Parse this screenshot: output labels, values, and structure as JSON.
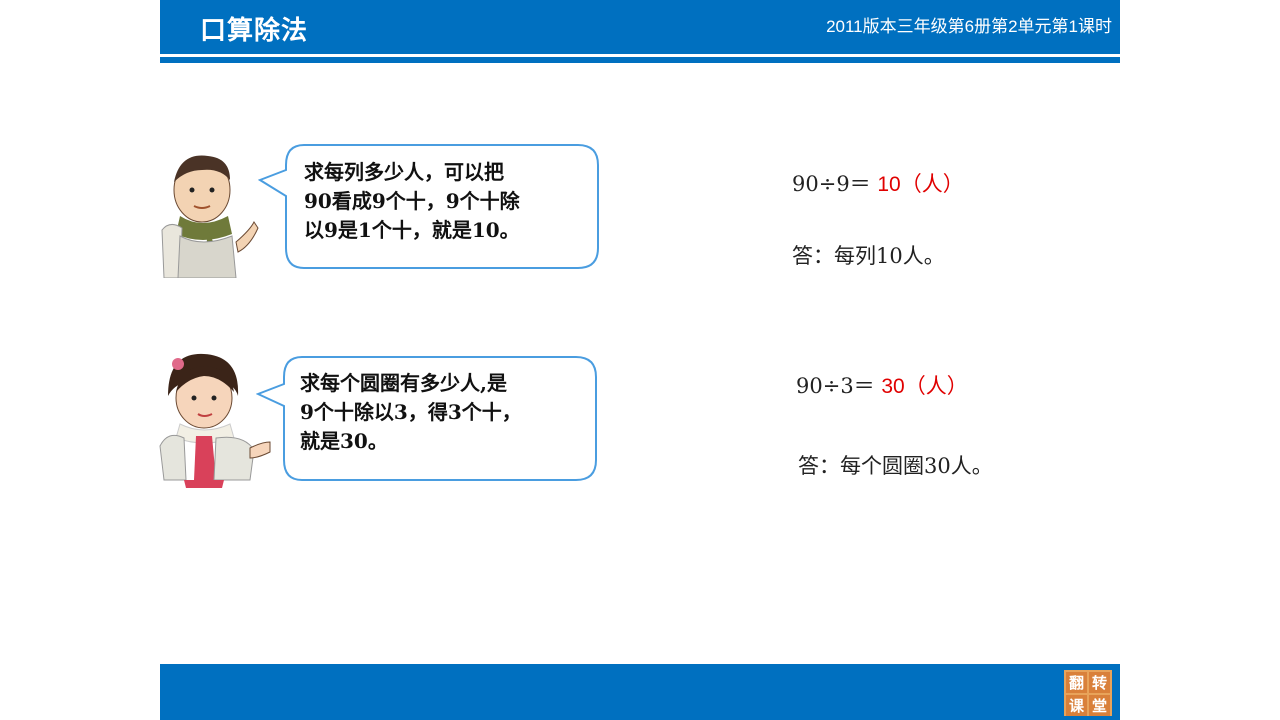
{
  "header": {
    "title": "口算除法",
    "subtitle": "2011版本三年级第6册第2单元第1课时"
  },
  "problems": [
    {
      "bubble_lines": [
        "求每列多少人，可以把",
        "90看成9个十，9个十除",
        "以9是1个十，就是10。"
      ],
      "equation": {
        "expr": "90÷9＝",
        "answer": "10",
        "unit": "（人）"
      },
      "answer_text": "答：每列10人。"
    },
    {
      "bubble_lines": [
        "求每个圆圈有多少人,是",
        "9个十除以3，得3个十，",
        "就是30。"
      ],
      "equation": {
        "expr": "90÷3＝",
        "answer": "30",
        "unit": "（人）"
      },
      "answer_text": "答：每个圆圈30人。"
    }
  ],
  "footer": {
    "logo_chars": [
      "翻",
      "转",
      "课",
      "堂"
    ]
  },
  "colors": {
    "brand_blue": "#0070c0",
    "bubble_border": "#4a9de0",
    "answer_red": "#e00000"
  }
}
